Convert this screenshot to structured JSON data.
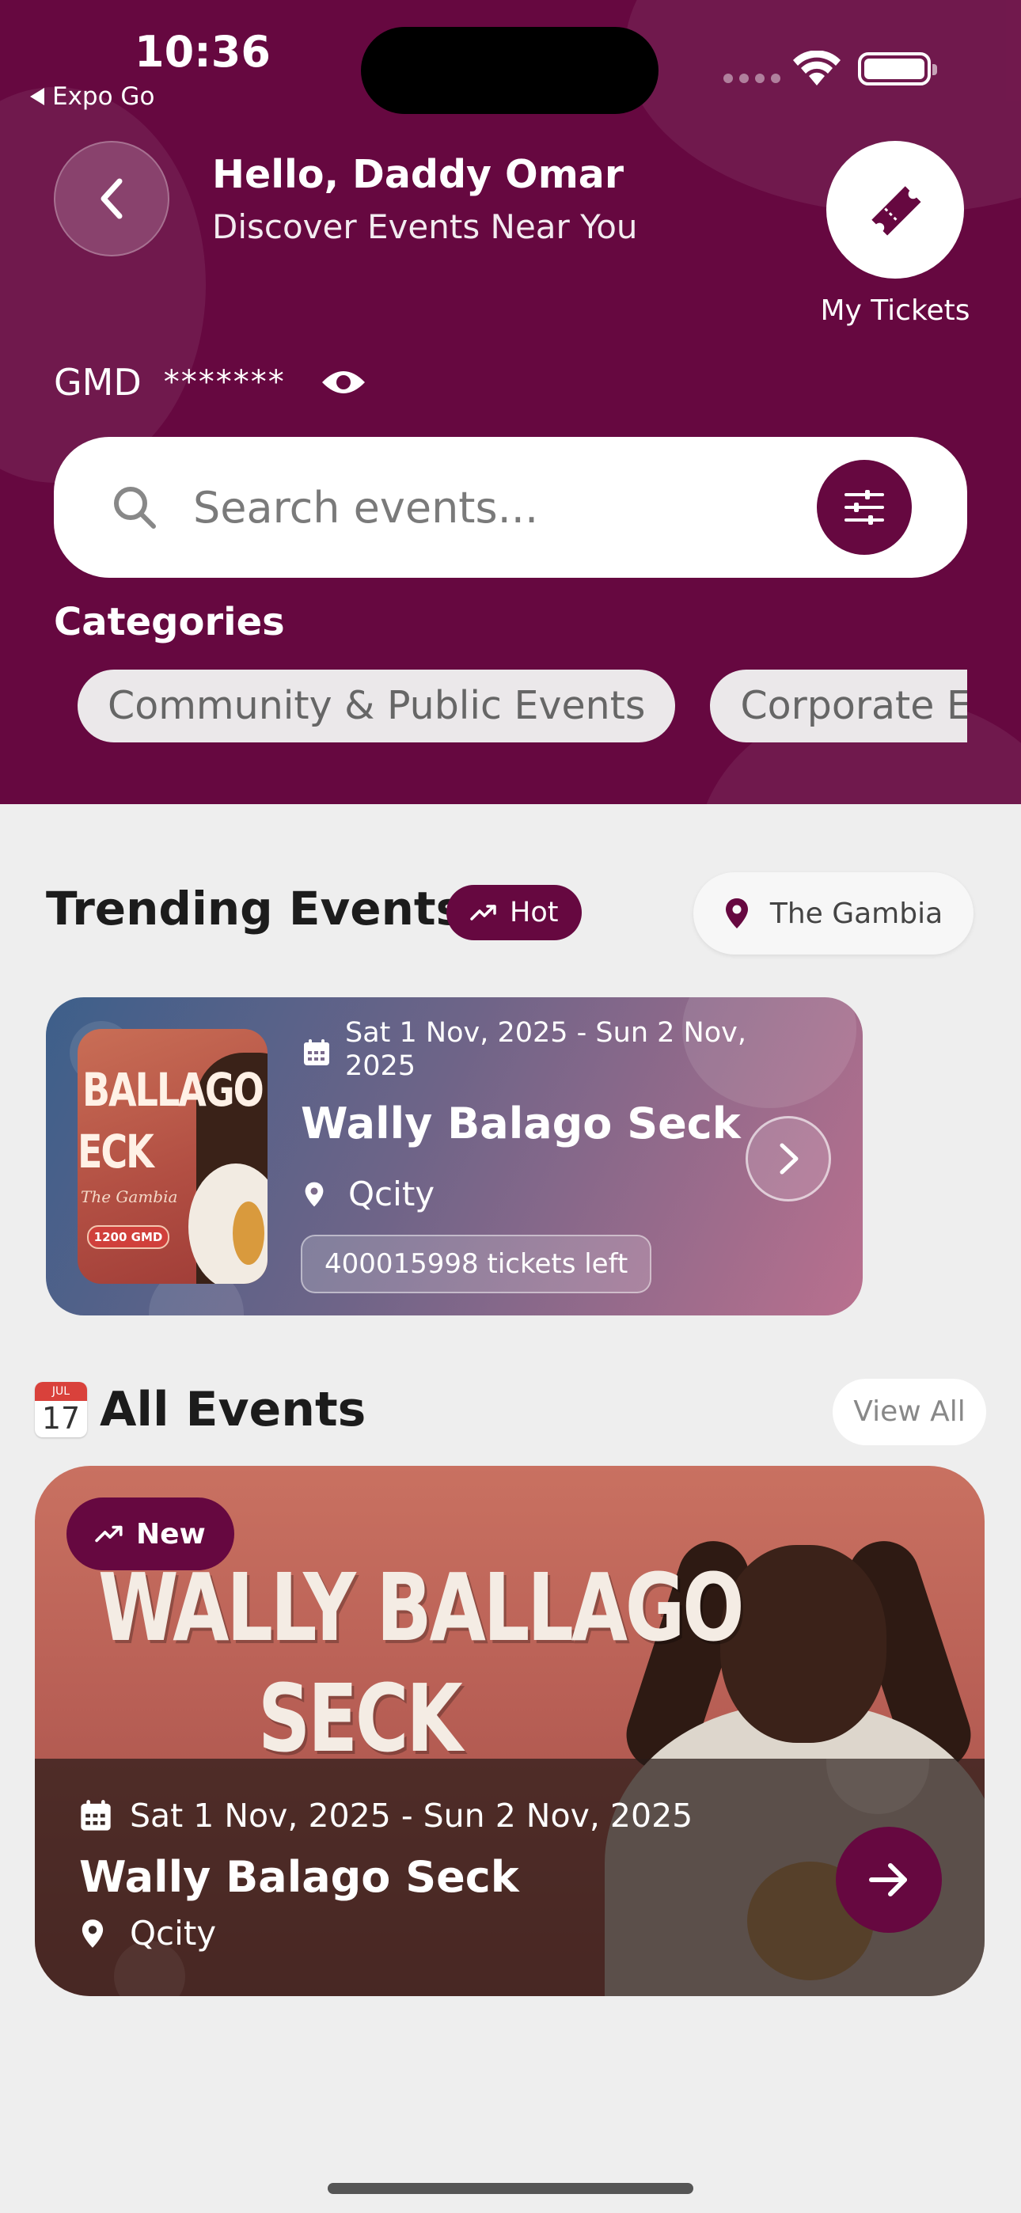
{
  "status_bar": {
    "time": "10:36",
    "back_app": "Expo Go"
  },
  "header": {
    "greeting": "Hello, Daddy Omar",
    "subtitle": "Discover Events Near You",
    "my_tickets_label": "My Tickets",
    "balance_currency": "GMD",
    "balance_masked": "*******",
    "search_placeholder": "Search events...",
    "categories_title": "Categories",
    "categories": [
      "Community & Public Events",
      "Corporate Events"
    ]
  },
  "trending": {
    "title": "Trending Events",
    "hot_label": "Hot",
    "location": "The Gambia",
    "card": {
      "date": "Sat 1 Nov, 2025 - Sun 2 Nov, 2025",
      "name": "Wally Balago Seck",
      "venue": "Qcity",
      "tickets_left": "400015998 tickets left",
      "poster_text_1": "BALLAGO",
      "poster_text_2": "ECK",
      "poster_text_3": "The Gambia",
      "poster_price": "1200 GMD"
    }
  },
  "all_events": {
    "title": "All Events",
    "calendar_month": "JUL",
    "calendar_day": "17",
    "view_all": "View All",
    "card": {
      "badge": "New",
      "banner_line_1": "WALLY BALLAGO",
      "banner_line_2": "SECK",
      "date": "Sat 1 Nov, 2025 - Sun 2 Nov, 2025",
      "name": "Wally Balago Seck",
      "venue": "Qcity"
    }
  },
  "colors": {
    "brand": "#660840",
    "background": "#eeeeee"
  }
}
